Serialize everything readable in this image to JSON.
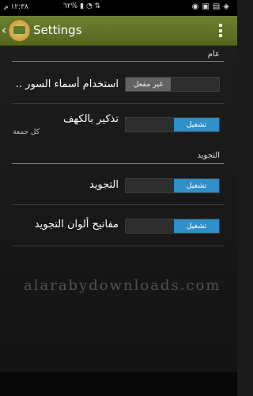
{
  "status_bar": {
    "time": "١٢:٣٨ م",
    "battery": "٦٢%",
    "icons_left": [
      "signal-icon",
      "wifi-icon",
      "data-icon"
    ],
    "icons_right": [
      "whatsapp-icon",
      "notification-icon",
      "gallery-icon",
      "notification-icon"
    ]
  },
  "action_bar": {
    "title": "Settings"
  },
  "sections": {
    "general": {
      "header": "عام",
      "surah_names": {
        "title": "استخدام أسماء السور ..",
        "state_label": "غير مفعل",
        "checked": false
      },
      "kahf_reminder": {
        "title": "تذكير بالكهف",
        "summary": "كل جمعة",
        "state_label": "تشغيل",
        "checked": true
      }
    },
    "tajweed": {
      "header": "التجويد",
      "tajweed": {
        "title": "التجويد",
        "state_label": "تشغيل",
        "checked": true
      },
      "tajweed_colors": {
        "title": "مفاتيح ألوان التجويد",
        "state_label": "تشغيل",
        "checked": true
      }
    }
  },
  "watermark": "alarabydownloads.com",
  "colors": {
    "action_bar": "#5f7226",
    "switch_on": "#2f8fc7",
    "switch_off": "#626262",
    "background": "#1b1b1b"
  }
}
